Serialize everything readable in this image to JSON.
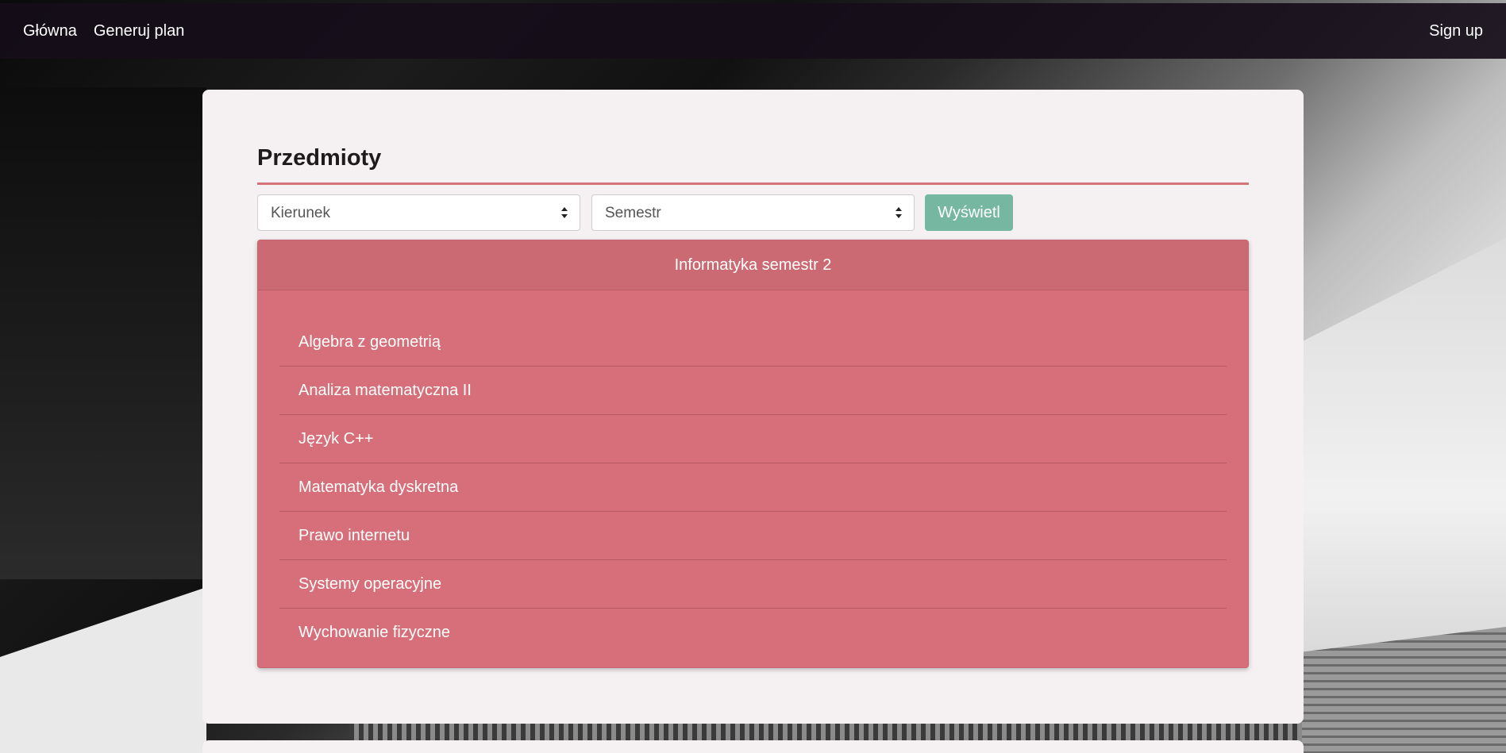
{
  "navbar": {
    "links": [
      {
        "label": "Główna"
      },
      {
        "label": "Generuj plan"
      }
    ],
    "signup_label": "Sign up"
  },
  "main": {
    "title": "Przedmioty",
    "filters": {
      "kierunek_selected": "Kierunek",
      "semestr_selected": "Semestr",
      "show_button_label": "Wyświetl"
    },
    "panel": {
      "header": "Informatyka semestr 2",
      "subjects": [
        "Algebra z geometrią",
        "Analiza matematyczna II",
        "Język C++",
        "Matematyka dyskretna",
        "Prawo internetu",
        "Systemy operacyjne",
        "Wychowanie fizyczne"
      ]
    }
  },
  "colors": {
    "navbar_bg": "#160e1a",
    "card_bg": "#f5f1f2",
    "accent_red": "#d66f79",
    "button_green": "#75b7a0"
  },
  "icons": {
    "select_arrow": "sort-updown-icon"
  }
}
